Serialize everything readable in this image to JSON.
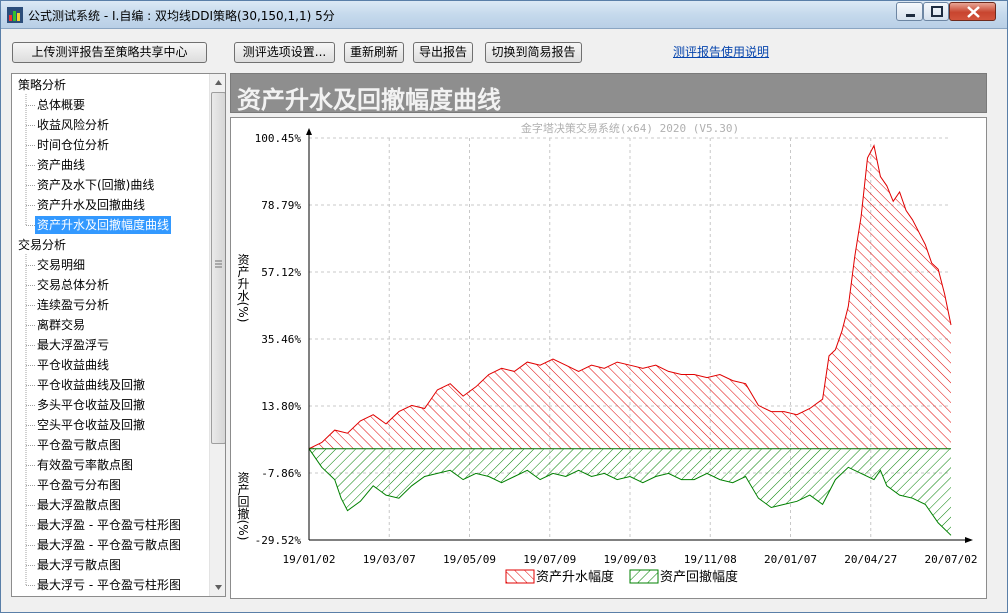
{
  "window": {
    "title": "公式测试系统 - I.自编 : 双均线DDI策略(30,150,1,1) 5分"
  },
  "toolbar": {
    "upload_label": "上传测评报告至策略共享中心",
    "options_label": "测评选项设置...",
    "refresh_label": "重新刷新",
    "export_label": "导出报告",
    "simple_label": "切换到简易报告",
    "help_link": "测评报告使用说明"
  },
  "sidebar": {
    "groups": [
      {
        "label": "策略分析",
        "items": [
          "总体概要",
          "收益风险分析",
          "时间仓位分析",
          "资产曲线",
          "资产及水下(回撤)曲线",
          "资产升水及回撤曲线",
          "资产升水及回撤幅度曲线"
        ]
      },
      {
        "label": "交易分析",
        "items": [
          "交易明细",
          "交易总体分析",
          "连续盈亏分析",
          "离群交易",
          "最大浮盈浮亏",
          "平仓收益曲线",
          "平仓收益曲线及回撤",
          "多头平仓收益及回撤",
          "空头平仓收益及回撤",
          "平仓盈亏散点图",
          "有效盈亏率散点图",
          "平仓盈亏分布图",
          "最大浮盈散点图",
          "最大浮盈 - 平仓盈亏柱形图",
          "最大浮盈 - 平仓盈亏散点图",
          "最大浮亏散点图",
          "最大浮亏 - 平仓盈亏柱形图"
        ]
      }
    ],
    "selected": "资产升水及回撤幅度曲线"
  },
  "panel": {
    "title": "资产升水及回撤幅度曲线"
  },
  "chart_data": {
    "type": "area",
    "watermark": "金字塔决策交易系统(x64) 2020 (V5.30)",
    "ylabel_top": "资产升水(%)",
    "ylabel_bottom": "资产回撤(%)",
    "y_ticks": [
      "100.45%",
      "78.79%",
      "57.12%",
      "35.46%",
      "13.80%",
      "-7.86%",
      "-29.52%"
    ],
    "y_tick_values": [
      100.45,
      78.79,
      57.12,
      35.46,
      13.8,
      -7.86,
      -29.52
    ],
    "ylim": [
      -29.52,
      100.45
    ],
    "x_ticks": [
      "19/01/02",
      "19/03/07",
      "19/05/09",
      "19/07/09",
      "19/09/03",
      "19/11/08",
      "20/01/07",
      "20/04/27",
      "20/07/02"
    ],
    "grid": true,
    "legend_position": "bottom",
    "series": [
      {
        "name": "资产升水幅度",
        "color": "#e00000",
        "points": [
          [
            0,
            0
          ],
          [
            2,
            2
          ],
          [
            4,
            6
          ],
          [
            6,
            5
          ],
          [
            8,
            9
          ],
          [
            10,
            11
          ],
          [
            12,
            8
          ],
          [
            14,
            12
          ],
          [
            16,
            14
          ],
          [
            18,
            13
          ],
          [
            20,
            19
          ],
          [
            22,
            21
          ],
          [
            24,
            17
          ],
          [
            26,
            20
          ],
          [
            28,
            24
          ],
          [
            30,
            26
          ],
          [
            32,
            25
          ],
          [
            34,
            28
          ],
          [
            36,
            27
          ],
          [
            38,
            29
          ],
          [
            40,
            27
          ],
          [
            42,
            25
          ],
          [
            44,
            27
          ],
          [
            46,
            26
          ],
          [
            48,
            28
          ],
          [
            50,
            27
          ],
          [
            52,
            26
          ],
          [
            54,
            27
          ],
          [
            56,
            25
          ],
          [
            58,
            24
          ],
          [
            60,
            24
          ],
          [
            62,
            23
          ],
          [
            64,
            24
          ],
          [
            66,
            22
          ],
          [
            68,
            21
          ],
          [
            70,
            14
          ],
          [
            72,
            12
          ],
          [
            74,
            12
          ],
          [
            76,
            11
          ],
          [
            78,
            13
          ],
          [
            80,
            16
          ],
          [
            81,
            30
          ],
          [
            82,
            32
          ],
          [
            83,
            38
          ],
          [
            84,
            46
          ],
          [
            85,
            62
          ],
          [
            86,
            75
          ],
          [
            87,
            94
          ],
          [
            88,
            98
          ],
          [
            89,
            88
          ],
          [
            90,
            85
          ],
          [
            91,
            80
          ],
          [
            92,
            83
          ],
          [
            93,
            77
          ],
          [
            94,
            74
          ],
          [
            95,
            70
          ],
          [
            96,
            66
          ],
          [
            97,
            60
          ],
          [
            98,
            58
          ],
          [
            99,
            50
          ],
          [
            100,
            40
          ]
        ]
      },
      {
        "name": "资产回撤幅度",
        "color": "#008000",
        "points": [
          [
            0,
            0
          ],
          [
            2,
            -6
          ],
          [
            4,
            -10
          ],
          [
            5,
            -16
          ],
          [
            6,
            -20
          ],
          [
            8,
            -17
          ],
          [
            10,
            -12
          ],
          [
            12,
            -15
          ],
          [
            14,
            -16
          ],
          [
            16,
            -12
          ],
          [
            18,
            -9
          ],
          [
            20,
            -8
          ],
          [
            22,
            -7
          ],
          [
            24,
            -10
          ],
          [
            26,
            -8
          ],
          [
            28,
            -9
          ],
          [
            30,
            -11
          ],
          [
            32,
            -9
          ],
          [
            34,
            -7
          ],
          [
            36,
            -10
          ],
          [
            38,
            -8
          ],
          [
            40,
            -9
          ],
          [
            42,
            -7
          ],
          [
            44,
            -9
          ],
          [
            46,
            -8
          ],
          [
            48,
            -10
          ],
          [
            50,
            -9
          ],
          [
            52,
            -11
          ],
          [
            54,
            -9
          ],
          [
            56,
            -8
          ],
          [
            58,
            -10
          ],
          [
            60,
            -10
          ],
          [
            62,
            -8
          ],
          [
            64,
            -10
          ],
          [
            66,
            -11
          ],
          [
            68,
            -9
          ],
          [
            70,
            -16
          ],
          [
            72,
            -19
          ],
          [
            74,
            -18
          ],
          [
            76,
            -17
          ],
          [
            78,
            -15
          ],
          [
            80,
            -18
          ],
          [
            82,
            -10
          ],
          [
            84,
            -6
          ],
          [
            86,
            -8
          ],
          [
            88,
            -10
          ],
          [
            89,
            -7
          ],
          [
            90,
            -12
          ],
          [
            92,
            -15
          ],
          [
            94,
            -16
          ],
          [
            96,
            -18
          ],
          [
            98,
            -24
          ],
          [
            100,
            -28
          ]
        ]
      }
    ]
  }
}
